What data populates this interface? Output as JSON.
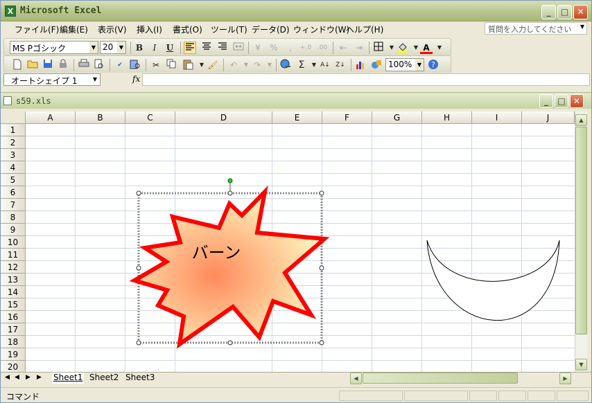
{
  "app": {
    "title": "Microsoft Excel",
    "icon": "excel-icon"
  },
  "window_buttons": {
    "minimize": "_",
    "maximize": "□",
    "close": "✕"
  },
  "menu": [
    {
      "label": "ファイル(F)"
    },
    {
      "label": "編集(E)"
    },
    {
      "label": "表示(V)"
    },
    {
      "label": "挿入(I)"
    },
    {
      "label": "書式(O)"
    },
    {
      "label": "ツール(T)"
    },
    {
      "label": "データ(D)"
    },
    {
      "label": "ウィンドウ(W)"
    },
    {
      "label": "ヘルプ(H)"
    }
  ],
  "help_search": {
    "placeholder": "質問を入力してください"
  },
  "format_toolbar": {
    "font": "MS Pゴシック",
    "size": "20",
    "bold": "B",
    "italic": "I",
    "underline": "U",
    "percent": "%",
    "comma": ","
  },
  "standard_toolbar": {
    "zoom": "100%",
    "sum": "Σ"
  },
  "formula_bar": {
    "name_box": "オートシェイプ 1",
    "fx": "fx",
    "value": ""
  },
  "workbook": {
    "name": "s59.xls"
  },
  "columns": [
    "A",
    "B",
    "C",
    "D",
    "E",
    "F",
    "G",
    "H",
    "I",
    "J"
  ],
  "rows": [
    "1",
    "2",
    "3",
    "4",
    "5",
    "6",
    "7",
    "8",
    "9",
    "10",
    "11",
    "12",
    "13",
    "14",
    "15",
    "16",
    "17",
    "18",
    "19",
    "20"
  ],
  "shapes": {
    "explosion_text": "バーン",
    "explosion_stroke": "#ff0000",
    "fill_center": "#ff8a5c",
    "fill_edge": "#fff8c0",
    "moon_stroke": "#000000"
  },
  "sheets": [
    {
      "label": "Sheet1",
      "active": true
    },
    {
      "label": "Sheet2",
      "active": false
    },
    {
      "label": "Sheet3",
      "active": false
    }
  ],
  "status": {
    "mode": "コマンド"
  }
}
